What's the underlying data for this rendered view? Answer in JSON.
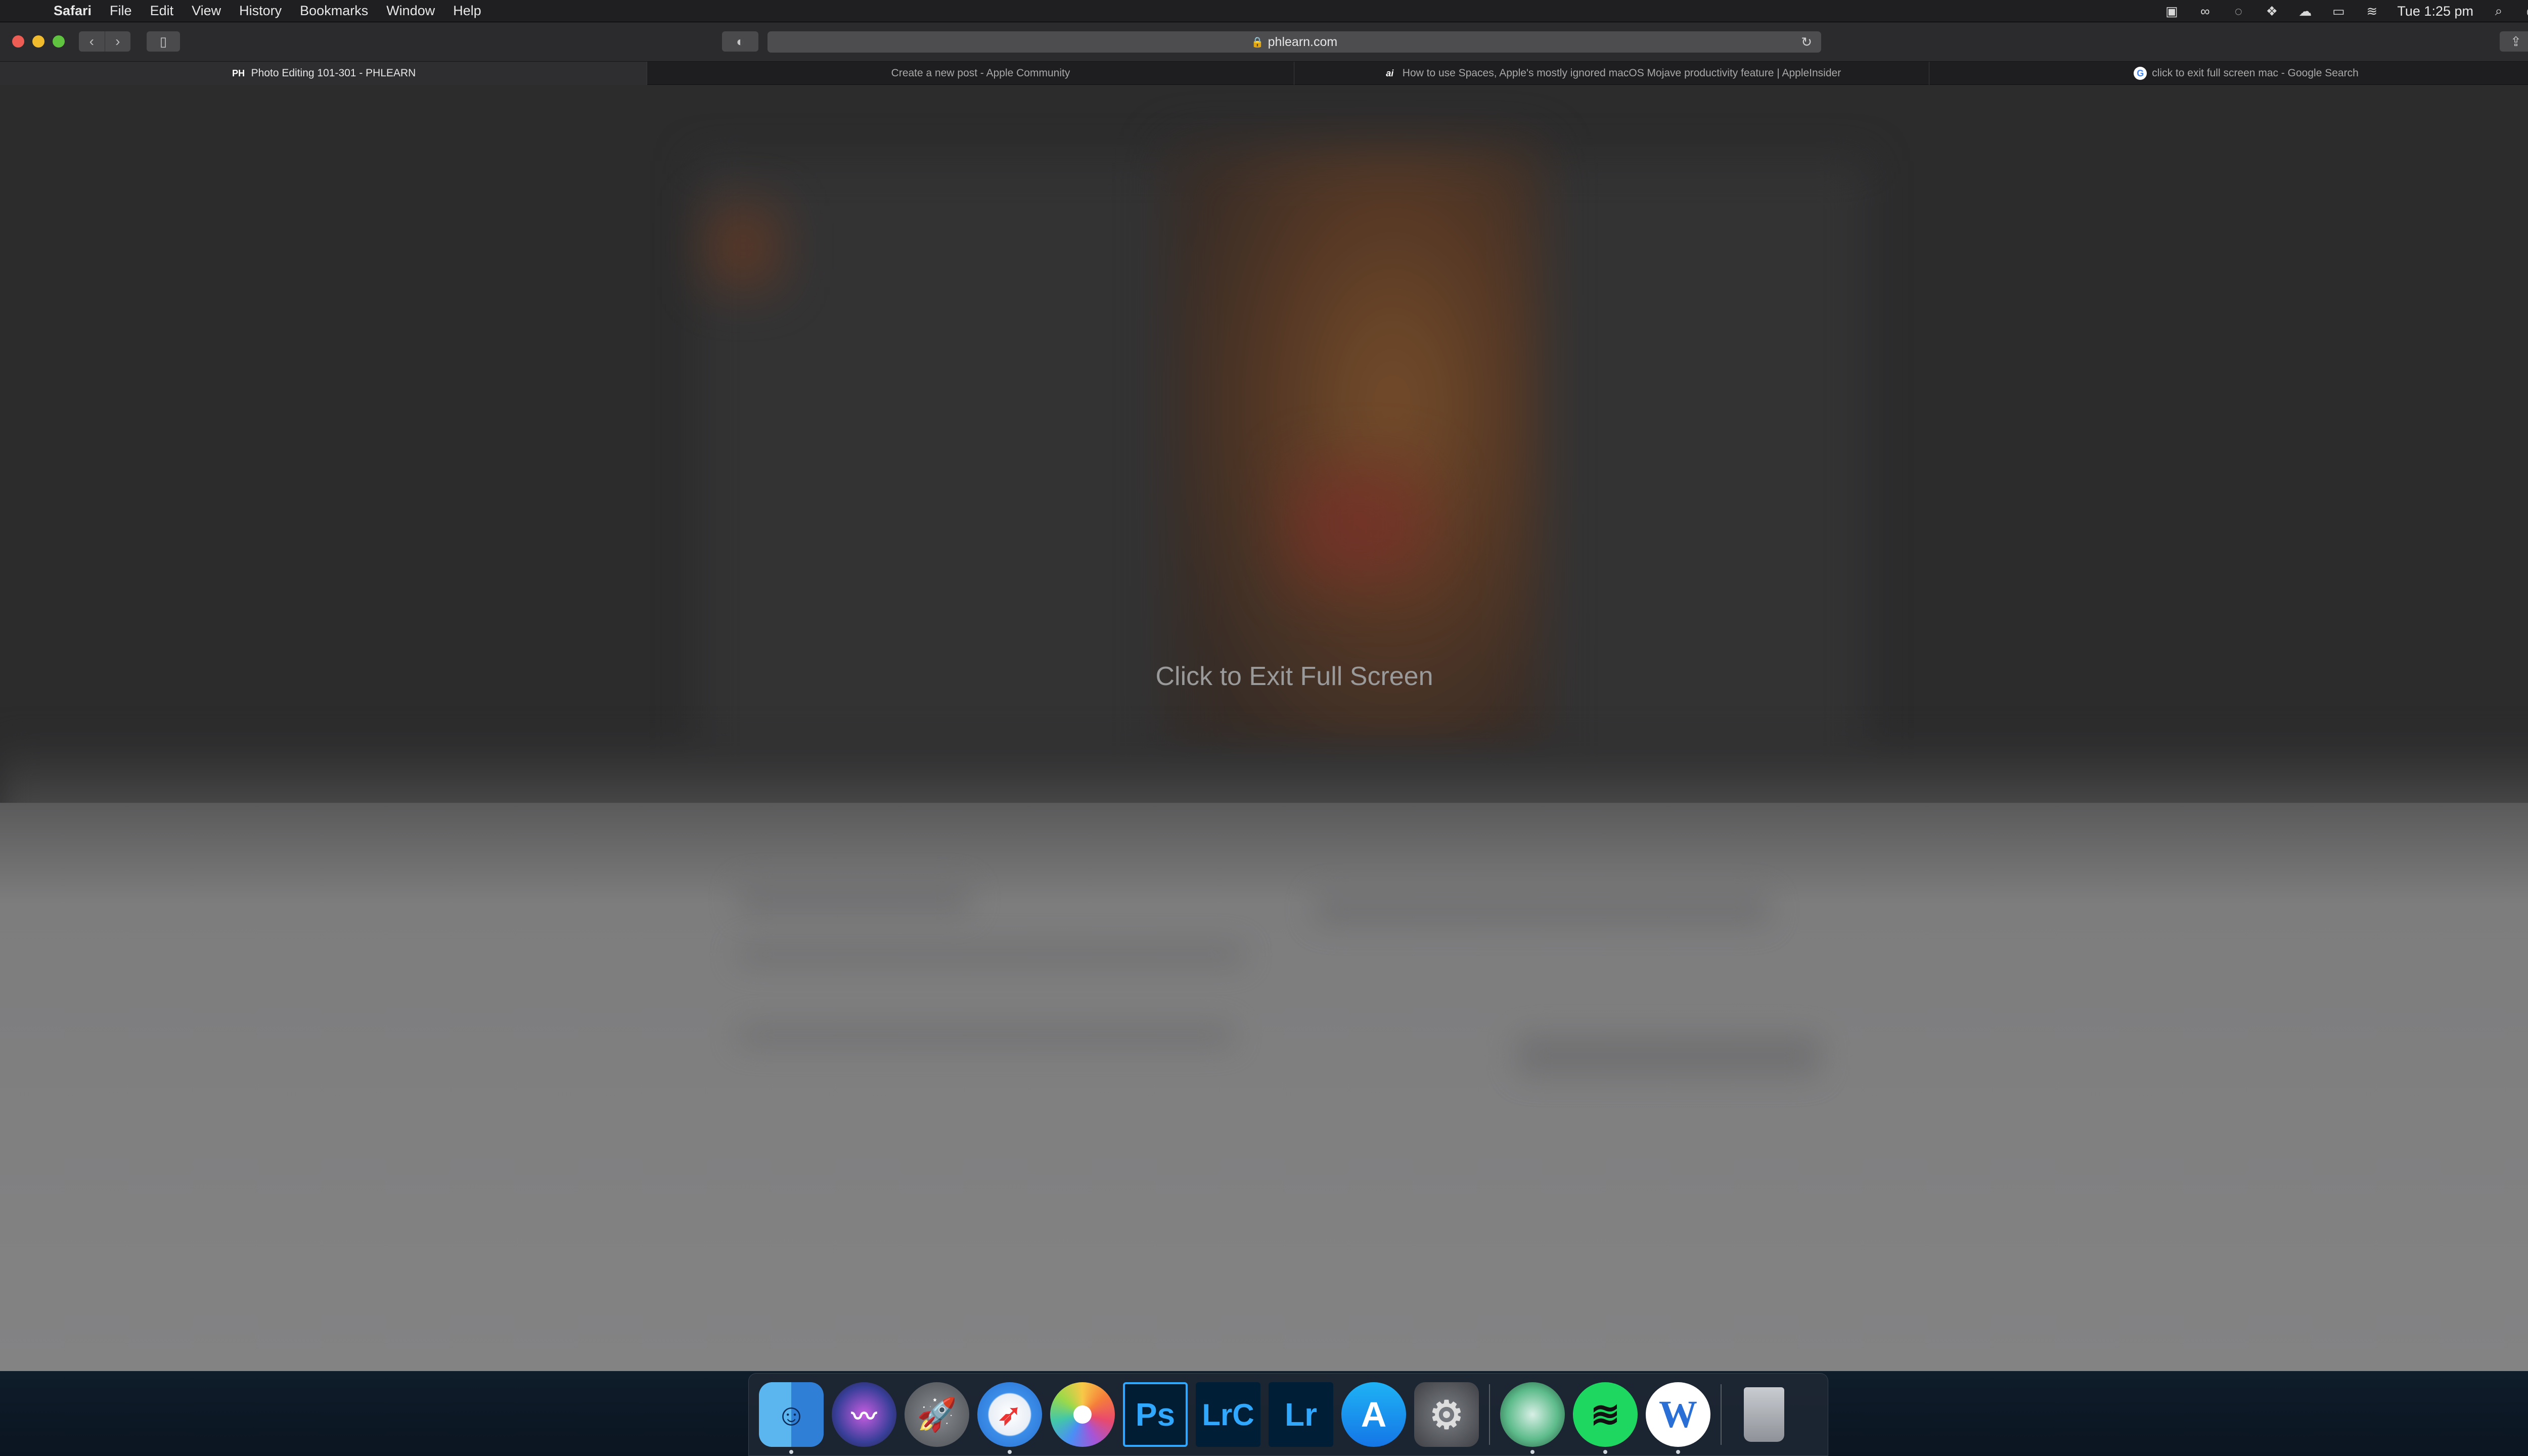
{
  "menubar": {
    "app": "Safari",
    "items": [
      "File",
      "Edit",
      "View",
      "History",
      "Bookmarks",
      "Window",
      "Help"
    ],
    "clock": "Tue 1:25 pm"
  },
  "toolbar": {
    "url": "phlearn.com"
  },
  "tabs": [
    {
      "title": "Photo Editing 101-301 - PHLEARN",
      "favicon": "PH",
      "active": true
    },
    {
      "title": "Create a new post - Apple Community",
      "favicon": "apple-icon",
      "active": false
    },
    {
      "title": "How to use Spaces, Apple's mostly ignored macOS Mojave productivity feature | AppleInsider",
      "favicon": "ai",
      "active": false
    },
    {
      "title": "click to exit full screen mac - Google Search",
      "favicon": "G",
      "active": false
    }
  ],
  "overlay": {
    "message": "Click to Exit Full Screen"
  },
  "dock": {
    "apps": [
      {
        "name": "Finder",
        "running": true
      },
      {
        "name": "Siri",
        "running": false
      },
      {
        "name": "Launchpad",
        "running": false
      },
      {
        "name": "Safari",
        "running": true
      },
      {
        "name": "Photos",
        "running": false
      },
      {
        "name": "Photoshop",
        "label": "Ps",
        "running": false
      },
      {
        "name": "Lightroom Classic",
        "label": "LrC",
        "running": false
      },
      {
        "name": "Lightroom",
        "label": "Lr",
        "running": false
      },
      {
        "name": "App Store",
        "running": false
      },
      {
        "name": "System Preferences",
        "running": false
      },
      {
        "name": "Camo",
        "running": true
      },
      {
        "name": "Spotify",
        "running": true
      },
      {
        "name": "Wunderlist",
        "label": "W",
        "running": true
      },
      {
        "name": "Trash",
        "running": false
      }
    ]
  }
}
